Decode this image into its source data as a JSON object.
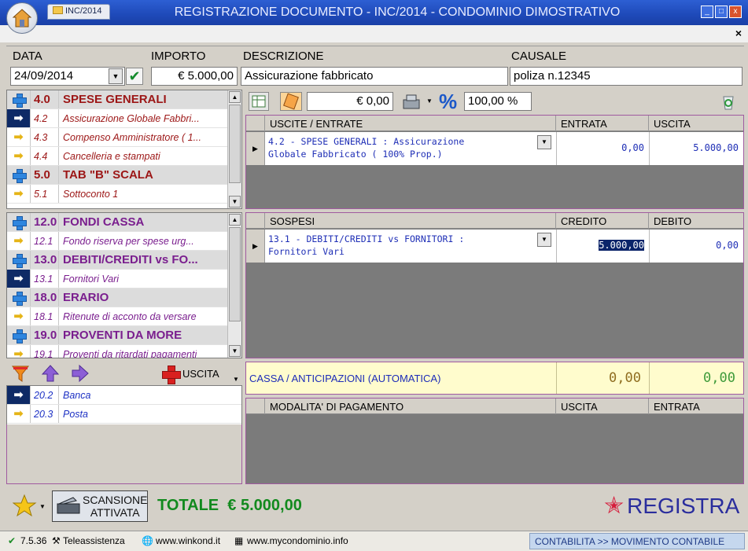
{
  "window": {
    "tab_label": "INC/2014",
    "title": "REGISTRAZIONE DOCUMENTO - INC/2014 - CONDOMINIO DIMOSTRATIVO",
    "btn_min": "_",
    "btn_max": "□",
    "btn_close": "x",
    "subbar_close": "×"
  },
  "header": {
    "data_label": "DATA",
    "data_value": "24/09/2014",
    "importo_label": "IMPORTO",
    "importo_value": "€ 5.000,00",
    "descrizione_label": "DESCRIZIONE",
    "descrizione_value": "Assicurazione fabbricato",
    "causale_label": "CAUSALE",
    "causale_value": "poliza n.12345"
  },
  "upper_accounts": [
    {
      "code": "4.0",
      "name": "SPESE GENERALI",
      "kind": "head",
      "color": "red"
    },
    {
      "code": "4.2",
      "name": "Assicurazione Globale Fabbri...",
      "kind": "sub",
      "color": "red",
      "selected": true
    },
    {
      "code": "4.3",
      "name": "Compenso Amministratore ( 1...",
      "kind": "sub",
      "color": "red"
    },
    {
      "code": "4.4",
      "name": "Cancelleria e stampati",
      "kind": "sub",
      "color": "red"
    },
    {
      "code": "5.0",
      "name": "TAB \"B\" SCALA",
      "kind": "head",
      "color": "red"
    },
    {
      "code": "5.1",
      "name": "Sottoconto 1",
      "kind": "sub",
      "color": "red"
    }
  ],
  "lower_accounts": [
    {
      "code": "12.0",
      "name": "FONDI CASSA",
      "kind": "head",
      "color": "pur"
    },
    {
      "code": "12.1",
      "name": "Fondo riserva per spese urg...",
      "kind": "sub",
      "color": "pur"
    },
    {
      "code": "13.0",
      "name": "DEBITI/CREDITI vs FO...",
      "kind": "head",
      "color": "pur"
    },
    {
      "code": "13.1",
      "name": "Fornitori Vari",
      "kind": "sub",
      "color": "pur",
      "selected": true
    },
    {
      "code": "18.0",
      "name": "ERARIO",
      "kind": "head",
      "color": "pur"
    },
    {
      "code": "18.1",
      "name": "Ritenute di acconto da versare",
      "kind": "sub",
      "color": "pur"
    },
    {
      "code": "19.0",
      "name": "PROVENTI DA MORE",
      "kind": "head",
      "color": "pur"
    },
    {
      "code": "19.1",
      "name": "Proventi da ritardati pagamenti",
      "kind": "sub",
      "color": "pur"
    }
  ],
  "payment_toolbar": {
    "uscita_label": "USCITA"
  },
  "payment_accounts": [
    {
      "code": "20.2",
      "name": "Banca",
      "kind": "sub",
      "color": "blu",
      "selected": true
    },
    {
      "code": "20.3",
      "name": "Posta",
      "kind": "sub",
      "color": "blu"
    }
  ],
  "right_toolbar": {
    "amount_value": "€ 0,00",
    "percent_value": "100,00 %"
  },
  "uscite_grid": {
    "col_desc": "USCITE / ENTRATE",
    "col_a": "ENTRATA",
    "col_b": "USCITA",
    "row_desc": "4.2 - SPESE GENERALI : Assicurazione\nGlobale Fabbricato ( 100% Prop.)",
    "row_a": "0,00",
    "row_b": "5.000,00"
  },
  "sospesi_grid": {
    "col_desc": "SOSPESI",
    "col_a": "CREDITO",
    "col_b": "DEBITO",
    "row_desc": "13.1 - DEBITI/CREDITI vs FORNITORI :\nFornitori Vari",
    "row_a": "5.000,00",
    "row_b": "0,00"
  },
  "cassa": {
    "label": "CASSA / ANTICIPAZIONI (AUTOMATICA)",
    "value_a": "0,00",
    "value_b": "0,00"
  },
  "modalita_grid": {
    "col_desc": "MODALITA' DI PAGAMENTO",
    "col_a": "USCITA",
    "col_b": "ENTRATA"
  },
  "bottom": {
    "scan_label_1": "SCANSIONE",
    "scan_label_2": "ATTIVATA",
    "totale_label": "TOTALE",
    "totale_value": "€ 5.000,00",
    "registra_label": "REGISTRA"
  },
  "statusbar": {
    "version": "7.5.36",
    "teleassistenza": "Teleassistenza",
    "site1": "www.winkond.it",
    "site2": "www.mycondominio.info",
    "breadcrumb": "CONTABILITA >> MOVIMENTO CONTABILE"
  }
}
